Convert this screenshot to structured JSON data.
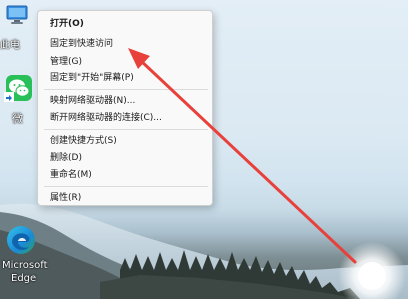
{
  "desktop": {
    "icons": [
      {
        "label": "此电",
        "icon": "this-pc-icon"
      },
      {
        "label": "微",
        "icon": "wechat-icon"
      },
      {
        "label": "Microsoft Edge",
        "line1": "Microsoft",
        "line2": "Edge",
        "icon": "edge-icon"
      }
    ]
  },
  "context_menu": {
    "items": [
      {
        "label": "打开(O)",
        "bold": true
      },
      {
        "label": "固定到快速访问"
      },
      {
        "label": "管理(G)"
      },
      {
        "label": "固定到\"开始\"屏幕(P)"
      },
      {
        "label": "映射网络驱动器(N)..."
      },
      {
        "label": "断开网络驱动器的连接(C)..."
      },
      {
        "label": "创建快捷方式(S)"
      },
      {
        "label": "删除(D)"
      },
      {
        "label": "重命名(M)"
      },
      {
        "label": "属性(R)"
      }
    ]
  },
  "annotation": {
    "arrow_color": "#e8403a",
    "target": "固定到快速访问"
  }
}
